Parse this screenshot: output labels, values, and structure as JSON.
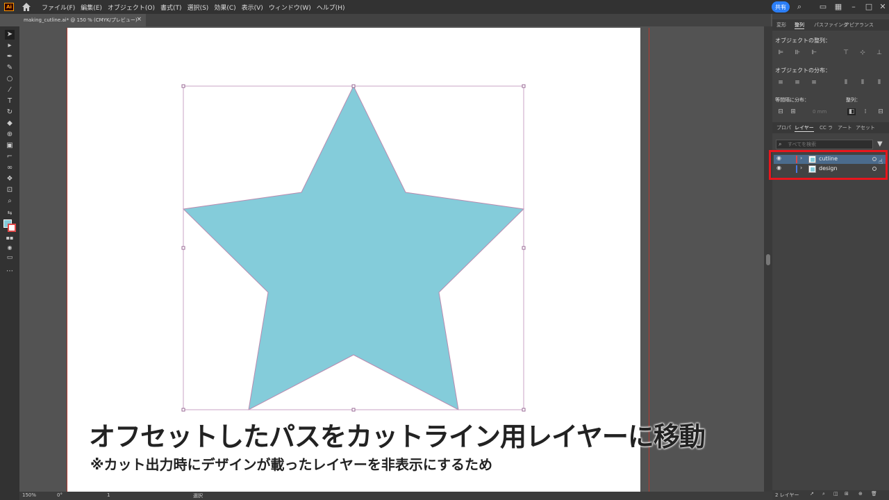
{
  "app": {
    "logo": "Ai",
    "menus": [
      "ファイル(F)",
      "編集(E)",
      "オブジェクト(O)",
      "書式(T)",
      "選択(S)",
      "効果(C)",
      "表示(V)",
      "ウィンドウ(W)",
      "ヘルプ(H)"
    ],
    "share_label": "共有"
  },
  "document": {
    "tab_title": "making_cutline.ai* @ 150 % (CMYK/プレビュー)",
    "close_glyph": "×"
  },
  "canvas": {
    "caption_main": "オフセットしたパスをカットライン用レイヤーに移動",
    "caption_sub": "※カット出力時にデザインが載ったレイヤーを非表示にするため",
    "star_fill": "#84ccda",
    "star_stroke": "#b98aaf"
  },
  "statusbar": {
    "zoom": "150%",
    "rotation": "0°",
    "artboard_num": "1",
    "tool_status": "選択"
  },
  "panel": {
    "top_tabs": [
      "変形",
      "整列",
      "パスファインダ",
      "アピアランス"
    ],
    "align_objects_label": "オブジェクトの整列：",
    "distribute_objects_label": "オブジェクトの分布：",
    "distribute_spacing_label": "等間隔に分布：",
    "align_to_label": "整列：",
    "spacing_value": "0 mm",
    "layer_tabs": [
      "プロパ",
      "レイヤー",
      "CC ラ",
      "アート",
      "アセット"
    ],
    "search_placeholder": "すべてを検索",
    "layers": [
      {
        "name": "cutline",
        "color": "#e04848",
        "selected": true
      },
      {
        "name": "design",
        "color": "#4a78e0",
        "selected": false
      }
    ],
    "layer_count": "2 レイヤー"
  }
}
